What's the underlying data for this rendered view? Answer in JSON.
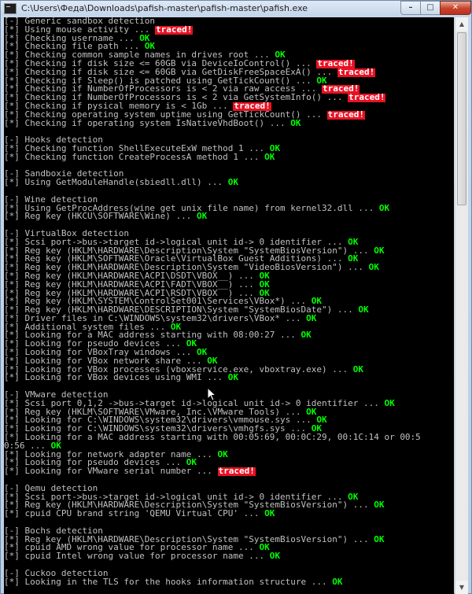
{
  "window": {
    "title": "C:\\Users\\Феда\\Downloads\\pafish-master\\pafish-master\\pafish.exe",
    "controls": {
      "minimize": "–",
      "maximize": "□",
      "close": "✕"
    }
  },
  "colors": {
    "ok": "#00ff00",
    "traced_bg": "#e81123",
    "text": "#c0c0c0",
    "console_bg": "#000000"
  },
  "icons": {
    "scroll_up": "▲",
    "scroll_down": "▼"
  },
  "console_lines": [
    {
      "text": "[-] Generic sandbox detection"
    },
    {
      "text": "[*] Using mouse activity ... ",
      "status": "traced!"
    },
    {
      "text": "[*] Checking username ... ",
      "status": "OK"
    },
    {
      "text": "[*] Checking file path ... ",
      "status": "OK"
    },
    {
      "text": "[*] Checking common sample names in drives root ... ",
      "status": "OK"
    },
    {
      "text": "[*] Checking if disk size <= 60GB via DeviceIoControl() ... ",
      "status": "traced!"
    },
    {
      "text": "[*] Checking if disk size <= 60GB via GetDiskFreeSpaceExA() ... ",
      "status": "traced!"
    },
    {
      "text": "[*] Checking if Sleep() is patched using GetTickCount() ... ",
      "status": "OK"
    },
    {
      "text": "[*] Checking if NumberOfProcessors is < 2 via raw access ... ",
      "status": "traced!"
    },
    {
      "text": "[*] Checking if NumberOfProcessors is < 2 via GetSystemInfo() ... ",
      "status": "traced!"
    },
    {
      "text": "[*] Checking if pysical memory is < 1Gb ... ",
      "status": "traced!"
    },
    {
      "text": "[*] Checking operating system uptime using GetTickCount() ... ",
      "status": "traced!"
    },
    {
      "text": "[*] Checking if operating system IsNativeVhdBoot() ... ",
      "status": "OK"
    },
    {
      "text": ""
    },
    {
      "text": "[-] Hooks detection"
    },
    {
      "text": "[*] Checking function ShellExecuteExW method 1 ... ",
      "status": "OK"
    },
    {
      "text": "[*] Checking function CreateProcessA method 1 ... ",
      "status": "OK"
    },
    {
      "text": ""
    },
    {
      "text": "[-] Sandboxie detection"
    },
    {
      "text": "[*] Using GetModuleHandle(sbiedll.dll) ... ",
      "status": "OK"
    },
    {
      "text": ""
    },
    {
      "text": "[-] Wine detection"
    },
    {
      "text": "[*] Using GetProcAddress(wine_get_unix_file_name) from kernel32.dll ... ",
      "status": "OK"
    },
    {
      "text": "[*] Reg key (HKCU\\SOFTWARE\\Wine) ... ",
      "status": "OK"
    },
    {
      "text": ""
    },
    {
      "text": "[-] VirtualBox detection"
    },
    {
      "text": "[*] Scsi port->bus->target id->logical unit id-> 0 identifier ... ",
      "status": "OK"
    },
    {
      "text": "[*] Reg key (HKLM\\HARDWARE\\Description\\System \"SystemBiosVersion\") ... ",
      "status": "OK"
    },
    {
      "text": "[*] Reg key (HKLM\\SOFTWARE\\Oracle\\VirtualBox Guest Additions) ... ",
      "status": "OK"
    },
    {
      "text": "[*] Reg key (HKLM\\HARDWARE\\Description\\System \"VideoBiosVersion\") ... ",
      "status": "OK"
    },
    {
      "text": "[*] Reg key (HKLM\\HARDWARE\\ACPI\\DSDT\\VBOX__) ... ",
      "status": "OK"
    },
    {
      "text": "[*] Reg key (HKLM\\HARDWARE\\ACPI\\FADT\\VBOX__) ... ",
      "status": "OK"
    },
    {
      "text": "[*] Reg key (HKLM\\HARDWARE\\ACPI\\RSDT\\VBOX__) ... ",
      "status": "OK"
    },
    {
      "text": "[*] Reg key (HKLM\\SYSTEM\\ControlSet001\\Services\\VBox*) ... ",
      "status": "OK"
    },
    {
      "text": "[*] Reg key (HKLM\\HARDWARE\\DESCRIPTION\\System \"SystemBiosDate\") ... ",
      "status": "OK"
    },
    {
      "text": "[*] Driver files in C:\\WINDOWS\\system32\\drivers\\VBox* ... ",
      "status": "OK"
    },
    {
      "text": "[*] Additional system files ... ",
      "status": "OK"
    },
    {
      "text": "[*] Looking for a MAC address starting with 08:00:27 ... ",
      "status": "OK"
    },
    {
      "text": "[*] Looking for pseudo devices ... ",
      "status": "OK"
    },
    {
      "text": "[*] Looking for VBoxTray windows ... ",
      "status": "OK"
    },
    {
      "text": "[*] Looking for VBox network share ... ",
      "status": "OK"
    },
    {
      "text": "[*] Looking for VBox processes (vboxservice.exe, vboxtray.exe) ... ",
      "status": "OK"
    },
    {
      "text": "[*] Looking for VBox devices using WMI ... ",
      "status": "OK"
    },
    {
      "text": ""
    },
    {
      "text": "[-] VMware detection"
    },
    {
      "text": "[*] Scsi port 0,1,2 ->bus->target id->logical unit id-> 0 identifier ... ",
      "status": "OK"
    },
    {
      "text": "[*] Reg key (HKLM\\SOFTWARE\\VMware, Inc.\\VMware Tools) ... ",
      "status": "OK"
    },
    {
      "text": "[*] Looking for C:\\WINDOWS\\system32\\drivers\\vmmouse.sys ... ",
      "status": "OK"
    },
    {
      "text": "[*] Looking for C:\\WINDOWS\\system32\\drivers\\vmhgfs.sys ... ",
      "status": "OK"
    },
    {
      "text": "[*] Looking for a MAC address starting with 00:05:69, 00:0C:29, 00:1C:14 or 00:5"
    },
    {
      "text": "0:56 ... ",
      "status": "OK"
    },
    {
      "text": "[*] Looking for network adapter name ... ",
      "status": "OK"
    },
    {
      "text": "[*] Looking for pseudo devices ... ",
      "status": "OK"
    },
    {
      "text": "[*] Looking for VMware serial number ... ",
      "status": "traced!"
    },
    {
      "text": ""
    },
    {
      "text": "[-] Qemu detection"
    },
    {
      "text": "[*] Scsi port->bus->target id->logical unit id-> 0 identifier ... ",
      "status": "OK"
    },
    {
      "text": "[*] Reg key (HKLM\\HARDWARE\\Description\\System \"SystemBiosVersion\") ... ",
      "status": "OK"
    },
    {
      "text": "[*] cpuid CPU brand string 'QEMU Virtual CPU' ... ",
      "status": "OK"
    },
    {
      "text": ""
    },
    {
      "text": "[-] Bochs detection"
    },
    {
      "text": "[*] Reg key (HKLM\\HARDWARE\\Description\\System \"SystemBiosVersion\") ... ",
      "status": "OK"
    },
    {
      "text": "[*] cpuid AMD wrong value for processor name ... ",
      "status": "OK"
    },
    {
      "text": "[*] cpuid Intel wrong value for processor name ... ",
      "status": "OK"
    },
    {
      "text": ""
    },
    {
      "text": "[-] Cuckoo detection"
    },
    {
      "text": "[*] Looking in the TLS for the hooks information structure ... ",
      "status": "OK"
    }
  ]
}
